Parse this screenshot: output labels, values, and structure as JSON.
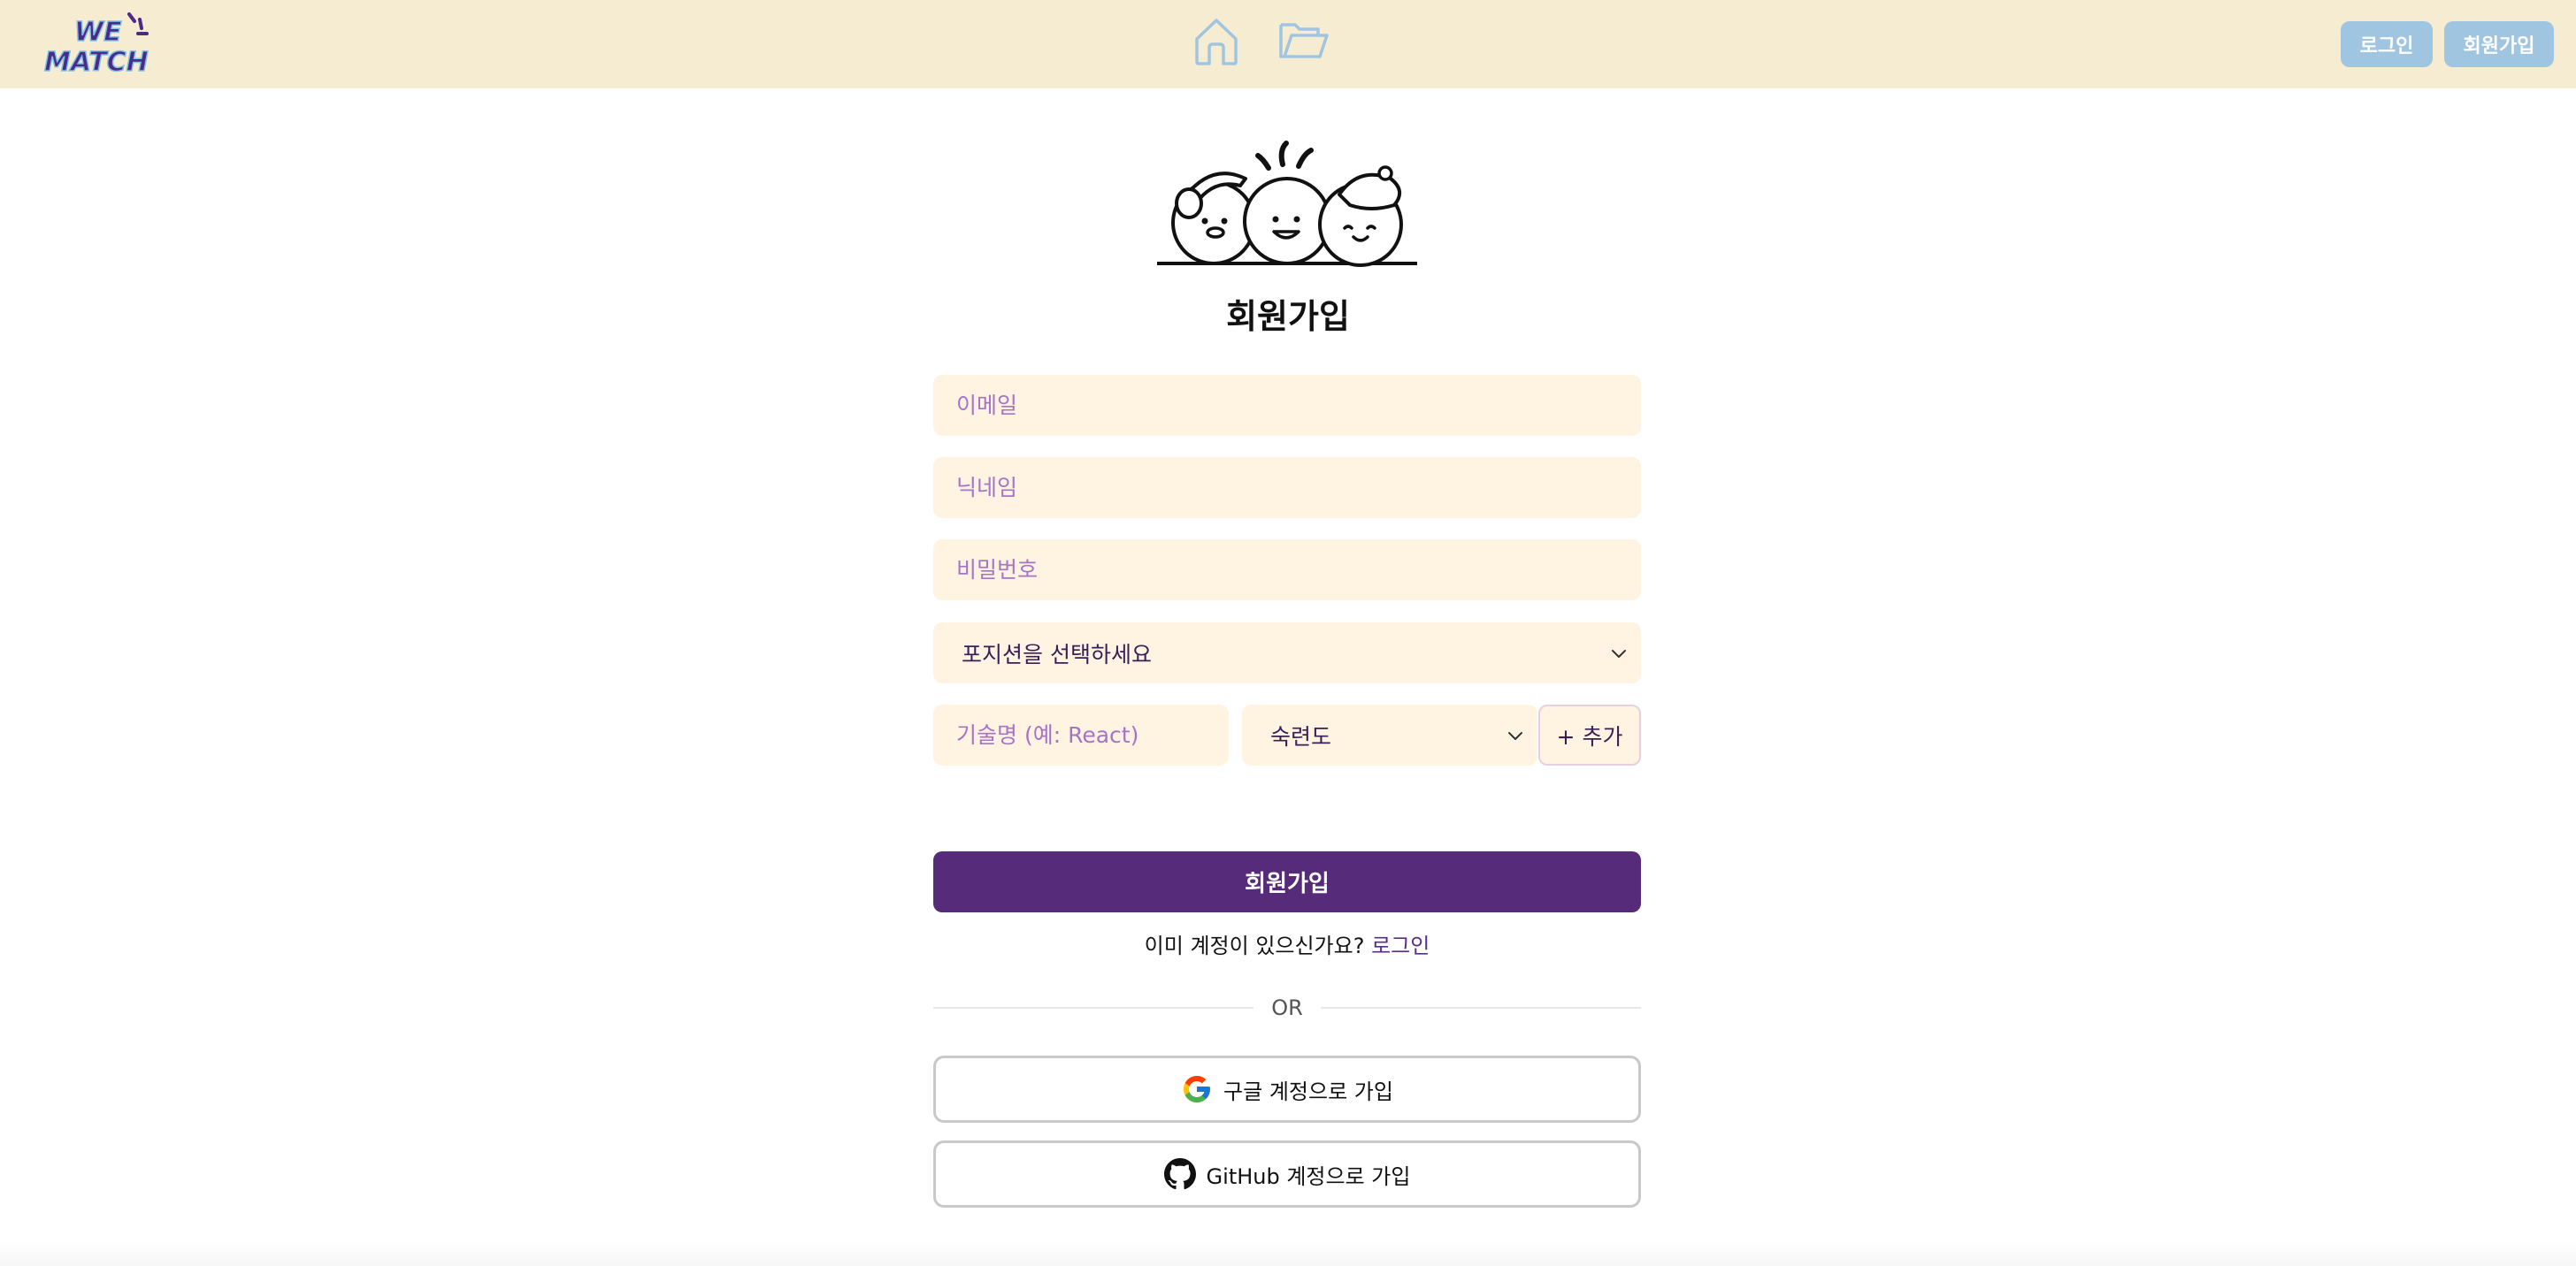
{
  "header": {
    "logo_text_line1": "WE",
    "logo_text_line2": "MATCH",
    "nav": [
      {
        "icon": "home-icon"
      },
      {
        "icon": "folder-icon"
      }
    ],
    "login_label": "로그인",
    "signup_label": "회원가입"
  },
  "form": {
    "title": "회원가입",
    "email_placeholder": "이메일",
    "nickname_placeholder": "닉네임",
    "password_placeholder": "비밀번호",
    "position_select": "포지션을 선택하세요",
    "skill_placeholder": "기술명 (예: React)",
    "level_select": "숙련도",
    "add_label": "+ 추가",
    "submit_label": "회원가입",
    "already_text": "이미 계정이 있으신가요?",
    "login_link": "로그인",
    "or_text": "OR",
    "google_label": "구글 계정으로 가입",
    "github_label": "GitHub 계정으로 가입"
  },
  "colors": {
    "header_bg": "#f6ecd1",
    "header_button": "#9fc5e0",
    "field_bg": "#fff4e2",
    "placeholder": "#a574c7",
    "primary": "#552b7a"
  }
}
